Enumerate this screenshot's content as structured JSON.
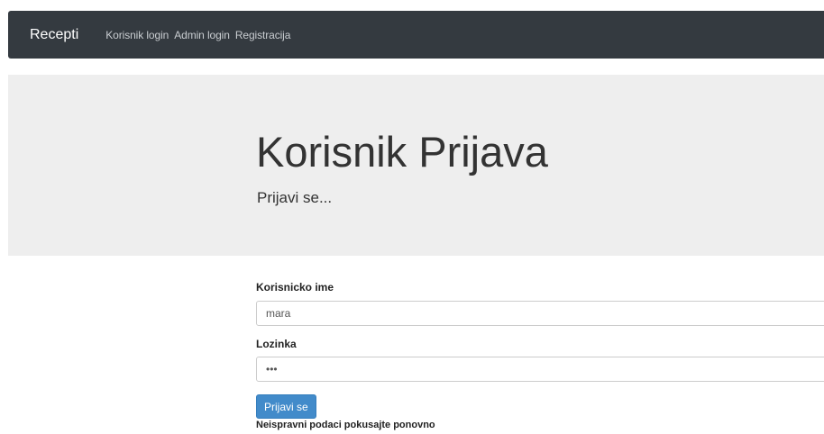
{
  "navbar": {
    "brand": "Recepti",
    "links": [
      {
        "label": "Korisnik login"
      },
      {
        "label": "Admin login"
      },
      {
        "label": "Registracija"
      }
    ]
  },
  "jumbotron": {
    "title": "Korisnik Prijava",
    "subtitle": "Prijavi se..."
  },
  "form": {
    "username_label": "Korisnicko ime",
    "username_value": "mara",
    "password_label": "Lozinka",
    "password_value": "•••",
    "submit_label": "Prijavi se",
    "error_message": "Neispravni podaci pokusajte ponovno"
  },
  "colors": {
    "navbar_bg": "#343a40",
    "jumbotron_bg": "#eeeeee",
    "button_bg": "#428bca"
  }
}
